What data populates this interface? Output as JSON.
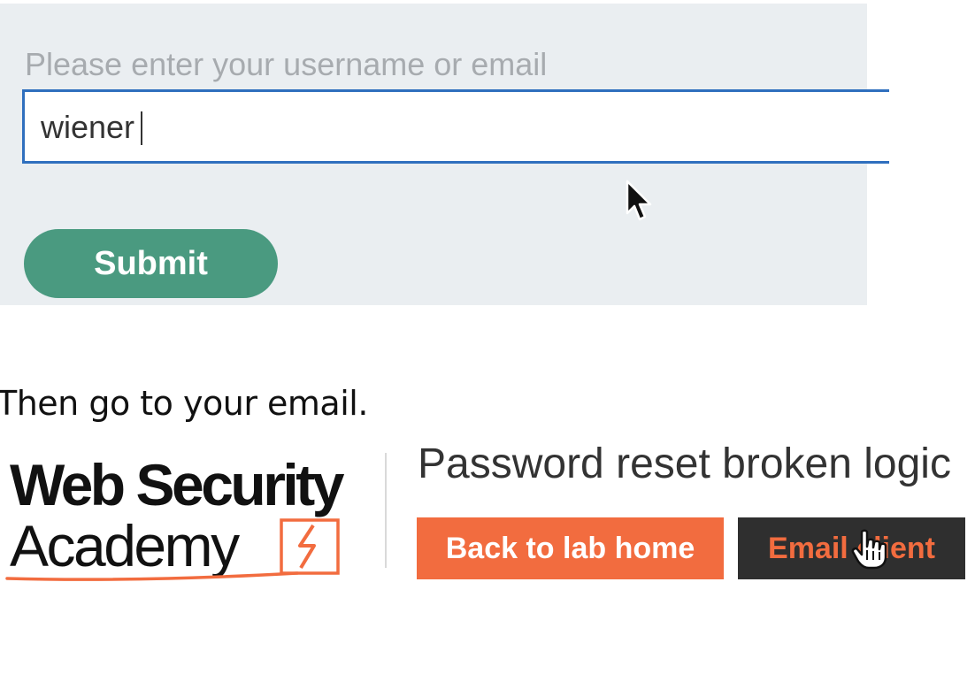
{
  "reset_form": {
    "label": "Please enter your username or email",
    "input_value": "wiener",
    "submit_label": "Submit"
  },
  "instruction": "Then go to your email.",
  "lab_header": {
    "logo_line1": "Web Security",
    "logo_line2": "Academy",
    "title": "Password reset broken logic",
    "back_button": "Back to lab home",
    "email_button": "Email client"
  },
  "colors": {
    "accent_orange": "#f26c3f",
    "submit_green": "#4a9a80",
    "input_focus_blue": "#2f6fbe",
    "panel_gray": "#eaeef1"
  },
  "icons": {
    "mouse_pointer": "arrow-cursor",
    "hover_pointer": "hand-cursor"
  }
}
